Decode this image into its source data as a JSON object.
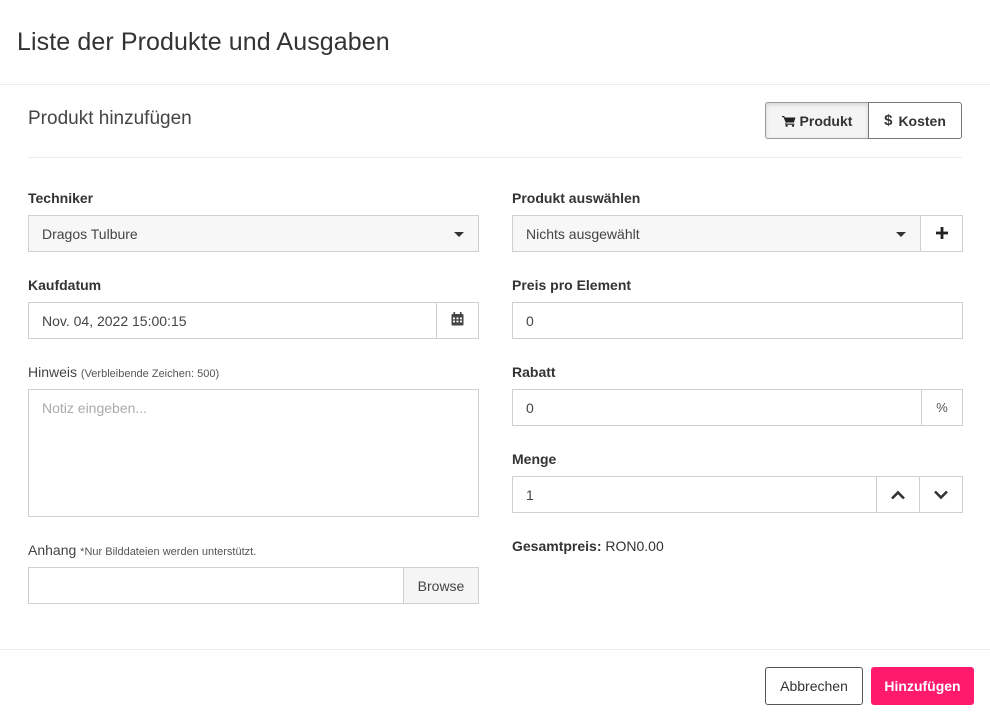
{
  "modal": {
    "title": "Liste der Produkte und Ausgaben"
  },
  "section": {
    "title": "Produkt hinzufügen",
    "toggle": {
      "product_label": "Produkt",
      "cost_label": "Kosten",
      "cost_symbol": "$"
    }
  },
  "form": {
    "technician": {
      "label": "Techniker",
      "value": "Dragos Tulbure"
    },
    "purchase_date": {
      "label": "Kaufdatum",
      "value": "Nov. 04, 2022 15:00:15"
    },
    "note": {
      "label": "Hinweis",
      "hint": "(Verbleibende Zeichen: 500)",
      "placeholder": "Notiz eingeben..."
    },
    "attachment": {
      "label": "Anhang",
      "hint": "*Nur Bilddateien werden unterstützt.",
      "browse_label": "Browse"
    },
    "product": {
      "label": "Produkt auswählen",
      "value": "Nichts ausgewählt"
    },
    "price": {
      "label": "Preis pro Element",
      "value": "0"
    },
    "discount": {
      "label": "Rabatt",
      "value": "0",
      "unit": "%"
    },
    "quantity": {
      "label": "Menge",
      "value": "1"
    },
    "total": {
      "label": "Gesamtpreis:",
      "value": "RON0.00"
    }
  },
  "footer": {
    "cancel_label": "Abbrechen",
    "submit_label": "Hinzufügen"
  },
  "colors": {
    "accent": "#ff1a6c",
    "border": "#cfcfcf",
    "field_grey": "#f7f7f7"
  },
  "icons": [
    "cart-icon",
    "dollar-icon",
    "caret-down-icon",
    "calendar-icon",
    "plus-icon",
    "chevron-up-icon",
    "chevron-down-icon"
  ]
}
